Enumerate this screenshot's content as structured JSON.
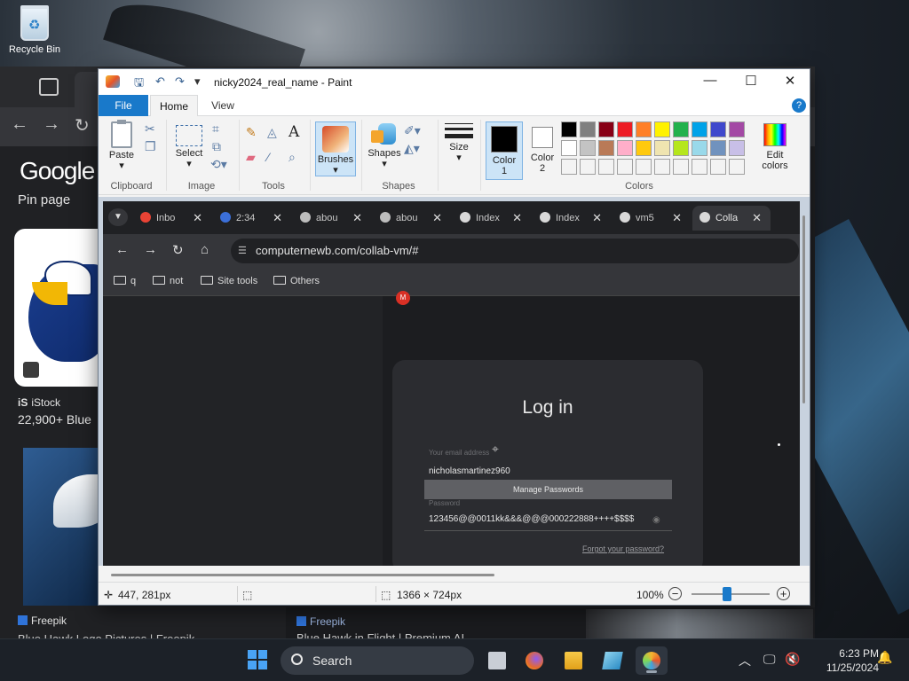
{
  "desktop": {
    "recycle_bin_label": "Recycle Bin"
  },
  "background_browser": {
    "google_logo": "Google",
    "pin_page": "Pin page",
    "result1_source": "iStock",
    "result1_title": "22,900+ Blue",
    "result2_source": "Freepik",
    "result2_title": "Blue Hawk Logo Pictures | Freepik",
    "result3_source": "Freepik",
    "result3_title": "Blue Hawk in Flight | Premium AI"
  },
  "paint": {
    "window_title": "nicky2024_real_name - Paint",
    "tabs": {
      "file": "File",
      "home": "Home",
      "view": "View"
    },
    "groups": {
      "clipboard": "Clipboard",
      "image": "Image",
      "tools": "Tools",
      "shapes": "Shapes",
      "colors": "Colors"
    },
    "buttons": {
      "paste": "Paste",
      "select": "Select",
      "brushes": "Brushes",
      "shapes": "Shapes",
      "size": "Size",
      "color1_line1": "Color",
      "color1_line2": "1",
      "color2_line1": "Color",
      "color2_line2": "2",
      "edit_colors_line1": "Edit",
      "edit_colors_line2": "colors"
    },
    "palette_rows": [
      [
        "#000000",
        "#7f7f7f",
        "#880015",
        "#ed1c24",
        "#ff7f27",
        "#fff200",
        "#22b14c",
        "#00a2e8",
        "#3f48cc",
        "#a349a4"
      ],
      [
        "#ffffff",
        "#c3c3c3",
        "#b97a57",
        "#ffaec9",
        "#ffc90e",
        "#efe4b0",
        "#b5e61d",
        "#99d9ea",
        "#7092be",
        "#c8bfe7"
      ],
      [
        "#f3f3f3",
        "#f3f3f3",
        "#f3f3f3",
        "#f3f3f3",
        "#f3f3f3",
        "#f3f3f3",
        "#f3f3f3",
        "#f3f3f3",
        "#f3f3f3",
        "#f3f3f3"
      ]
    ],
    "status": {
      "cursor_position": "447, 281px",
      "image_size": "1366 × 724px",
      "zoom": "100%",
      "zoom_fraction": 0.45
    }
  },
  "canvas_browser": {
    "tabs": [
      {
        "label": "Inbo",
        "favicon": "gmail-icon"
      },
      {
        "label": "2:34",
        "favicon": "blue-app-icon"
      },
      {
        "label": "abou",
        "favicon": "globe-icon"
      },
      {
        "label": "abou",
        "favicon": "globe-icon"
      },
      {
        "label": "Index",
        "favicon": "collabvm-icon"
      },
      {
        "label": "Index",
        "favicon": "collabvm-icon"
      },
      {
        "label": "vm5",
        "favicon": "collabvm-icon"
      },
      {
        "label": "Colla",
        "favicon": "collabvm-icon"
      }
    ],
    "url": "computernewb.com/collab-vm/#",
    "bookmarks": [
      "q",
      "not",
      "Site tools",
      "Others"
    ],
    "login": {
      "title": "Log in",
      "email_label": "Your email address",
      "email_value": "nicholasmartinez960",
      "manage_passwords": "Manage Passwords",
      "password_label": "Password",
      "password_value": "123456@@0011kk&&&@@@000222888++++$$$$",
      "forgot": "Forgot your password?"
    }
  },
  "taskbar": {
    "search_label": "Search",
    "time": "6:23 PM",
    "date": "11/25/2024"
  }
}
